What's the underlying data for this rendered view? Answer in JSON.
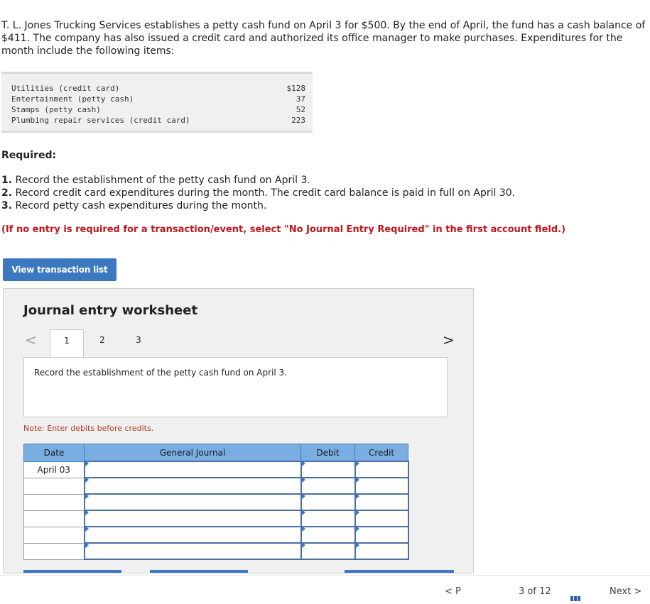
{
  "intro": "T. L. Jones Trucking Services establishes a petty cash fund on April 3 for $500. By the end of April, the fund has a cash balance of $411. The company has also issued a credit card and authorized its office manager to make purchases. Expenditures for the month include the following items:",
  "items": [
    {
      "label": "Utilities (credit card)",
      "amount": "$128"
    },
    {
      "label": "Entertainment (petty cash)",
      "amount": "37"
    },
    {
      "label": "Stamps (petty cash)",
      "amount": "52"
    },
    {
      "label": "Plumbing repair services (credit card)",
      "amount": "223"
    }
  ],
  "required": {
    "heading": "Required:",
    "steps": [
      {
        "num": "1.",
        "text": " Record the establishment of the petty cash fund on April 3."
      },
      {
        "num": "2.",
        "text": " Record credit card expenditures during the month. The credit card balance is paid in full on April 30."
      },
      {
        "num": "3.",
        "text": " Record petty cash expenditures during the month."
      }
    ],
    "instruction": "(If no entry is required for a transaction/event, select \"No Journal Entry Required\" in the first account field.)"
  },
  "view_button": "View transaction list",
  "worksheet": {
    "title": "Journal entry worksheet",
    "nav_prev": "<",
    "nav_next": ">",
    "tabs": [
      "1",
      "2",
      "3"
    ],
    "active_tab": "1",
    "prompt": "Record the establishment of the petty cash fund on April 3.",
    "note": "Note: Enter debits before credits.",
    "columns": {
      "date": "Date",
      "journal": "General Journal",
      "debit": "Debit",
      "credit": "Credit"
    },
    "rows": [
      {
        "date": "April 03"
      },
      {
        "date": ""
      },
      {
        "date": ""
      },
      {
        "date": ""
      },
      {
        "date": ""
      },
      {
        "date": ""
      }
    ]
  },
  "footer": {
    "prev_fragment": "< P",
    "page_fragment": "3 of 12",
    "next_fragment": "Next >"
  },
  "colors": {
    "accent": "#3b78c0",
    "header": "#7aaee3",
    "alert": "#c0161c"
  }
}
